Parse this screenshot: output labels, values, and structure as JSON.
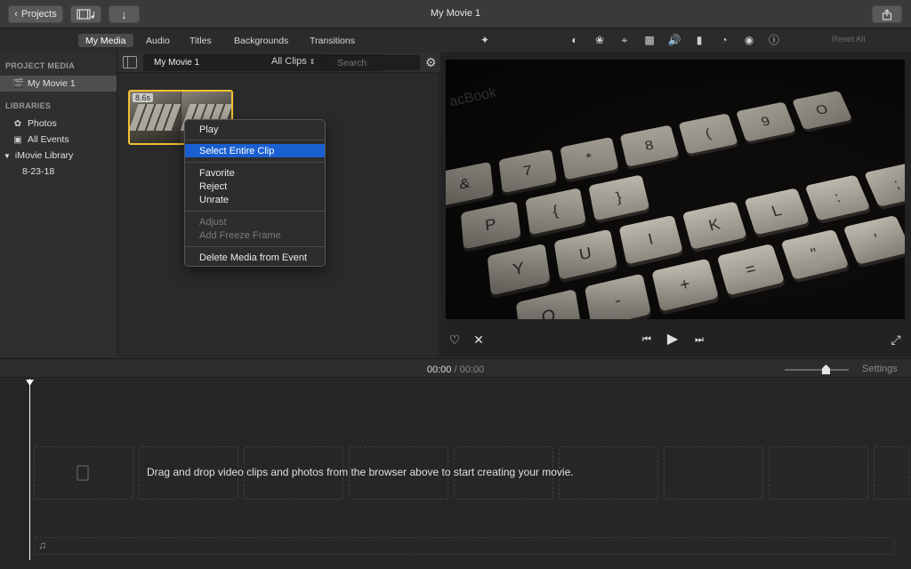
{
  "window": {
    "title": "My Movie 1"
  },
  "toolbar": {
    "projects_label": "Projects",
    "projects_icon": "chevron-left-icon",
    "media_icon": "filmstrip-music-icon",
    "import_icon": "arrow-down-icon",
    "share_icon": "share-icon"
  },
  "tabs": [
    {
      "label": "My Media",
      "active": true
    },
    {
      "label": "Audio"
    },
    {
      "label": "Titles"
    },
    {
      "label": "Backgrounds"
    },
    {
      "label": "Transitions"
    }
  ],
  "sidebar": {
    "project_media_header": "PROJECT MEDIA",
    "project_item": "My Movie 1",
    "libraries_header": "LIBRARIES",
    "photos": "Photos",
    "all_events": "All Events",
    "library": "iMovie Library",
    "event": "8-23-18"
  },
  "browser": {
    "event_name": "My Movie 1",
    "filter": "All Clips",
    "filter_icon": "updown-chevron-icon",
    "search_placeholder": "Search",
    "clip_duration": "8.6s"
  },
  "context_menu": {
    "play": "Play",
    "select_entire_clip": "Select Entire Clip",
    "favorite": "Favorite",
    "reject": "Reject",
    "unrate": "Unrate",
    "adjust": "Adjust",
    "add_freeze_frame": "Add Freeze Frame",
    "delete_media": "Delete Media from Event"
  },
  "viewer_toolbar": {
    "icons": [
      "magic-wand-icon",
      "color-balance-icon",
      "color-correction-icon",
      "crop-icon",
      "stabilization-icon",
      "volume-icon",
      "equalizer-icon",
      "speed-icon",
      "filter-icon",
      "info-icon"
    ],
    "reset_all": "Reset All"
  },
  "video": {
    "brand_text": "acBook",
    "keys": [
      "&",
      "7",
      "*",
      "8",
      "(",
      "9",
      "O",
      "P",
      "{",
      "}",
      "Y",
      "U",
      "I",
      "K",
      "L",
      ":",
      ";",
      "O",
      "-",
      "+",
      "=",
      "\"",
      "'"
    ]
  },
  "playback": {
    "favorite_icon": "heart-icon",
    "reject_icon": "x-icon",
    "prev_icon": "skip-back-icon",
    "play_icon": "play-icon",
    "next_icon": "skip-forward-icon",
    "fullscreen_icon": "fullscreen-icon"
  },
  "timeline": {
    "current_time": "00:00",
    "separator": "/",
    "duration": "00:00",
    "settings": "Settings",
    "drop_message": "Drag and drop video clips and photos from the browser above to start creating your movie."
  }
}
